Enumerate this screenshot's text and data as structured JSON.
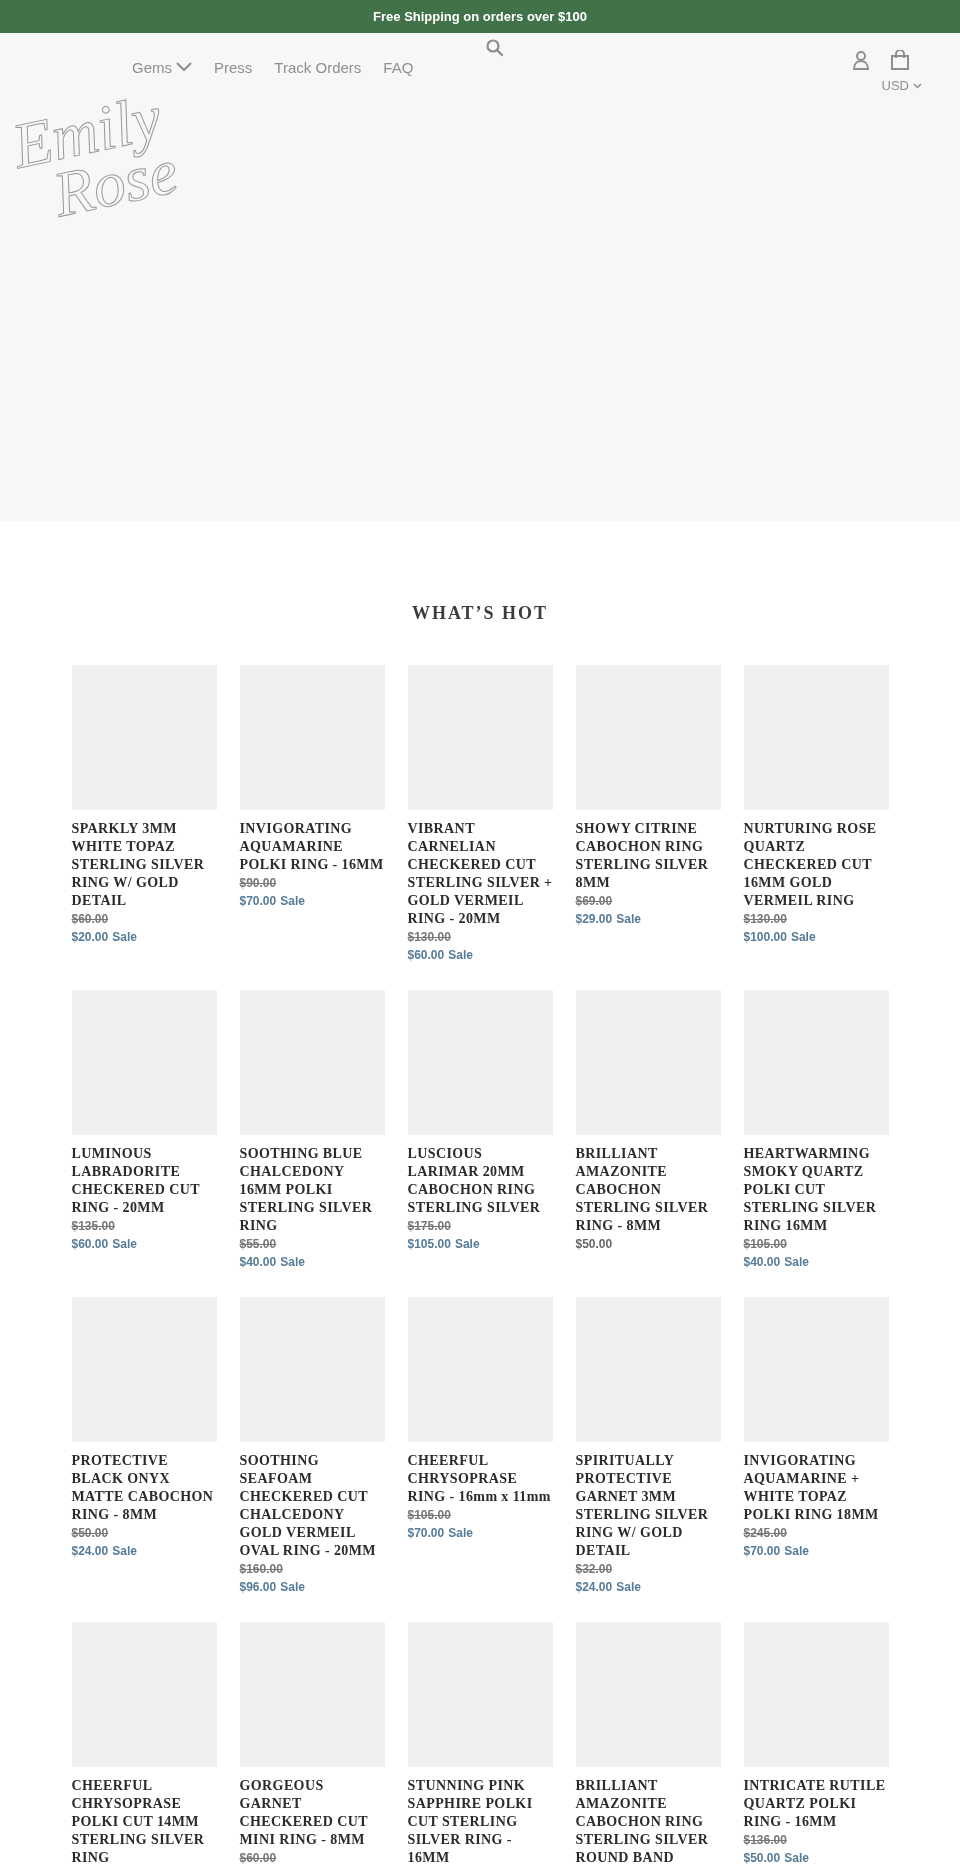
{
  "announcement": "Free Shipping on orders over $100",
  "nav": [
    {
      "label": "Gems",
      "dropdown": true
    },
    {
      "label": "Press",
      "dropdown": false
    },
    {
      "label": "Track Orders",
      "dropdown": false
    },
    {
      "label": "FAQ",
      "dropdown": false
    }
  ],
  "logo": [
    "Emily",
    "Rose"
  ],
  "currency": "USD",
  "section_title": "WHAT’S HOT",
  "products": [
    {
      "title": "SPARKLY 3MM WHITE TOPAZ STERLING SILVER RING W/ GOLD DETAIL",
      "compare_price": "$60.00",
      "price": "$20.00",
      "sale_label": "Sale"
    },
    {
      "title": "INVIGORATING AQUAMARINE POLKI RING - 16MM",
      "compare_price": "$90.00",
      "price": "$70.00",
      "sale_label": "Sale"
    },
    {
      "title": "VIBRANT CARNELIAN CHECKERED CUT STERLING SILVER + GOLD VERMEIL RING - 20MM",
      "compare_price": "$130.00",
      "price": "$60.00",
      "sale_label": "Sale"
    },
    {
      "title": "SHOWY CITRINE CABOCHON RING STERLING SILVER 8MM",
      "compare_price": "$69.00",
      "price": "$29.00",
      "sale_label": "Sale"
    },
    {
      "title": "NURTURING ROSE QUARTZ CHECKERED CUT 16MM GOLD VERMEIL RING",
      "compare_price": "$130.00",
      "price": "$100.00",
      "sale_label": "Sale"
    },
    {
      "title": "LUMINOUS LABRADORITE CHECKERED CUT RING - 20MM",
      "compare_price": "$135.00",
      "price": "$60.00",
      "sale_label": "Sale"
    },
    {
      "title": "SOOTHING BLUE CHALCEDONY 16MM POLKI STERLING SILVER RING",
      "compare_price": "$55.00",
      "price": "$40.00",
      "sale_label": "Sale"
    },
    {
      "title": "LUSCIOUS LARIMAR 20MM CABOCHON RING STERLING SILVER",
      "compare_price": "$175.00",
      "price": "$105.00",
      "sale_label": "Sale"
    },
    {
      "title": "BRILLIANT AMAZONITE CABOCHON STERLING SILVER RING - 8MM",
      "price": "$50.00"
    },
    {
      "title": "HEARTWARMING SMOKY QUARTZ POLKI CUT STERLING SILVER RING 16MM",
      "compare_price": "$105.00",
      "price": "$40.00",
      "sale_label": "Sale"
    },
    {
      "title": "PROTECTIVE BLACK ONYX MATTE CABOCHON RING - 8MM",
      "compare_price": "$50.00",
      "price": "$24.00",
      "sale_label": "Sale"
    },
    {
      "title": "SOOTHING SEAFOAM CHECKERED CUT CHALCEDONY GOLD VERMEIL OVAL RING - 20MM",
      "compare_price": "$160.00",
      "price": "$96.00",
      "sale_label": "Sale"
    },
    {
      "title": "CHEERFUL CHRYSOPRASE RING - 16mm x 11mm",
      "compare_price": "$105.00",
      "price": "$70.00",
      "sale_label": "Sale"
    },
    {
      "title": "SPIRITUALLY PROTECTIVE GARNET 3MM STERLING SILVER RING W/ GOLD DETAIL",
      "compare_price": "$32.00",
      "price": "$24.00",
      "sale_label": "Sale"
    },
    {
      "title": "INVIGORATING AQUAMARINE + WHITE TOPAZ POLKI RING 18MM",
      "compare_price": "$245.00",
      "price": "$70.00",
      "sale_label": "Sale"
    },
    {
      "title": "CHEERFUL CHRYSOPRASE POLKI CUT 14MM STERLING SILVER RING"
    },
    {
      "title": "GORGEOUS GARNET CHECKERED CUT MINI RING - 8MM",
      "compare_price": "$60.00"
    },
    {
      "title": "STUNNING PINK SAPPHIRE POLKI CUT STERLING SILVER RING - 16MM"
    },
    {
      "title": "BRILLIANT AMAZONITE CABOCHON RING STERLING SILVER ROUND BAND"
    },
    {
      "title": "INTRICATE RUTILE QUARTZ POLKI RING - 16MM",
      "compare_price": "$136.00",
      "price": "$50.00",
      "sale_label": "Sale"
    }
  ]
}
